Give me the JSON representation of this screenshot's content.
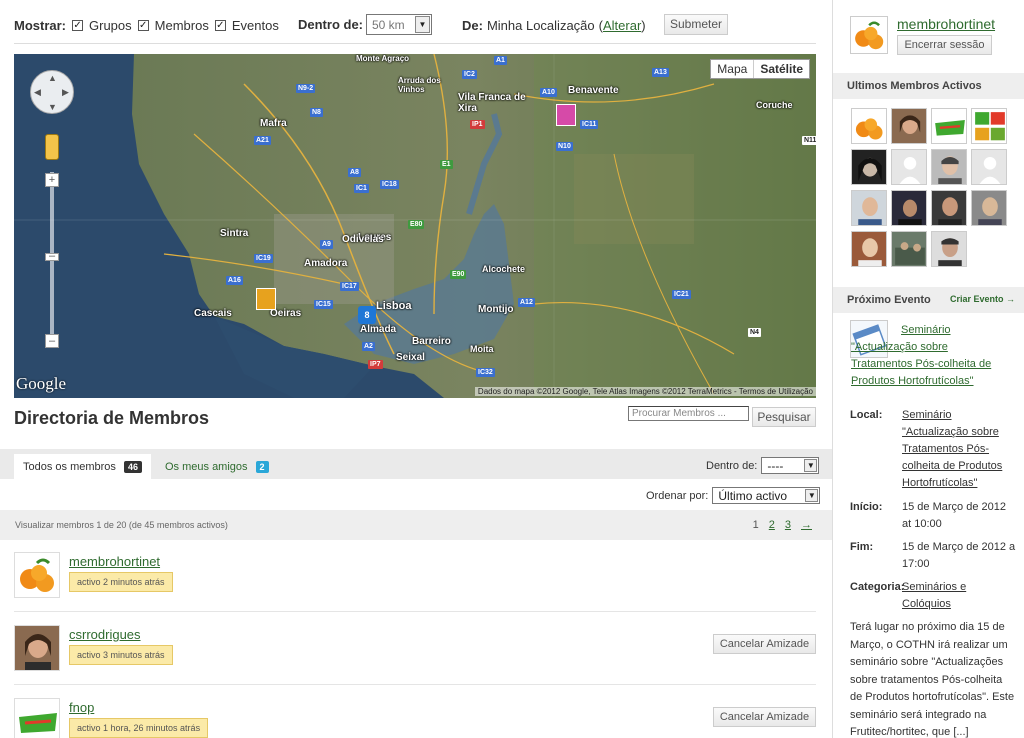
{
  "filters": {
    "show_label": "Mostrar:",
    "options": [
      "Grupos",
      "Membros",
      "Eventos"
    ],
    "within_label": "Dentro de:",
    "within_value": "50 km",
    "from_label": "De:",
    "from_value": "Minha Localização",
    "change_open": "(",
    "change_link": "Alterar",
    "change_close": ")",
    "submit_label": "Submeter"
  },
  "map": {
    "type_options": [
      "Mapa",
      "Satélite"
    ],
    "active_type": "Satélite",
    "cluster_count": "8",
    "logo": "Google",
    "attribution": "Dados do mapa ©2012 Google, Tele Atlas Imagens ©2012 TerraMetrics - Termos de Utilização",
    "places": [
      {
        "name": "Vila Franca de Xira"
      },
      {
        "name": "Benavente"
      },
      {
        "name": "Mafra"
      },
      {
        "name": "Loures"
      },
      {
        "name": "Sintra"
      },
      {
        "name": "Odivelas"
      },
      {
        "name": "Amadora"
      },
      {
        "name": "Alcochete"
      },
      {
        "name": "Cascais"
      },
      {
        "name": "Oeiras"
      },
      {
        "name": "Lisboa"
      },
      {
        "name": "Almada"
      },
      {
        "name": "Barreiro"
      },
      {
        "name": "Montijo"
      },
      {
        "name": "Seixal"
      },
      {
        "name": "Moita"
      },
      {
        "name": "Coruche"
      },
      {
        "name": "Monte Agraço"
      },
      {
        "name": "Arruda dos Vinhos"
      }
    ],
    "roads": [
      "A1",
      "IC2",
      "A10",
      "A13",
      "N9-2",
      "N8",
      "A21",
      "IP1",
      "IC11",
      "N10",
      "A8",
      "IC1",
      "IC18",
      "E1",
      "E80",
      "IC19",
      "A9",
      "A16",
      "IC15",
      "IC17",
      "E90",
      "A12",
      "A2",
      "IP7",
      "IC32",
      "N4",
      "N11",
      "IC21"
    ]
  },
  "directory": {
    "title": "Directoria de Membros",
    "search_placeholder": "Procurar Membros ...",
    "search_button": "Pesquisar",
    "tabs": [
      {
        "label": "Todos os membros",
        "count": "46"
      },
      {
        "label": "Os meus amigos",
        "count": "2"
      }
    ],
    "within_label": "Dentro de:",
    "within_value": "----",
    "order_label": "Ordenar por:",
    "order_value": "Último activo",
    "count_text": "Visualizar membros 1 de 20 (de 45 membros activos)",
    "pages": [
      "1",
      "2",
      "3",
      "→"
    ],
    "members": [
      {
        "name": "membrohortinet",
        "status": "activo 2 minutos atrás",
        "button": ""
      },
      {
        "name": "csrrodrigues",
        "status": "activo 3 minutos atrás",
        "button": "Cancelar Amizade"
      },
      {
        "name": "fnop",
        "status": "activo 1 hora, 26 minutos atrás",
        "button": "Cancelar Amizade"
      }
    ]
  },
  "sidebar": {
    "user": "membrohortinet",
    "logout": "Encerrar sessão",
    "recent_title": "Ultimos Membros Activos",
    "event_title": "Próximo Evento",
    "create_event": "Criar Evento →",
    "event": {
      "name": "Seminário \"Actualização sobre Tratamentos Pós-colheita de Produtos Hortofrutícolas\"",
      "local_label": "Local:",
      "local_value": "Seminário \"Actualização sobre Tratamentos Pós-colheita de Produtos Hortofrutícolas\"",
      "start_label": "Início:",
      "start_value": "15 de Março de 2012 at 10:00",
      "end_label": "Fim:",
      "end_value": "15 de Março de 2012 a 17:00",
      "category_label": "Categoria:",
      "category_value": "Seminários e Colóquios",
      "description": "Terá lugar no próximo dia 15 de Março, o COTHN irá realizar um seminário sobre \"Actualizações sobre tratamentos Pós-colheita de Produtos hortofrutícolas\". Este seminário será integrado na Frutitec/hortitec, que [...]"
    }
  }
}
